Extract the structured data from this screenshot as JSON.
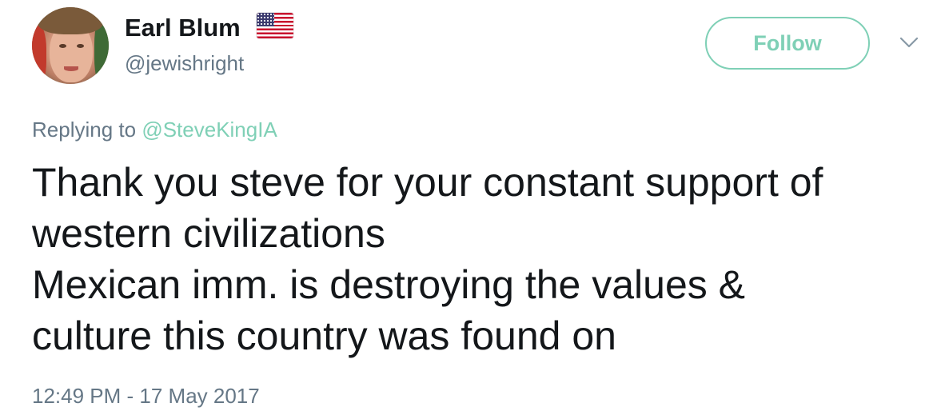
{
  "author": {
    "name": "Earl Blum",
    "flag_icon": "us-flag-icon",
    "handle": "@jewishright"
  },
  "follow_button": {
    "label": "Follow",
    "color": "#7fd0b6"
  },
  "menu": {
    "icon": "chevron-down-icon"
  },
  "reply": {
    "prefix": "Replying to",
    "mention": "@SteveKingIA"
  },
  "tweet": {
    "lines": [
      "Thank you steve for your constant support of",
      "western civilizations",
      "Mexican imm. is destroying the values &",
      "culture this country was found on"
    ],
    "timestamp": "12:49 PM - 17 May 2017"
  },
  "colors": {
    "text": "#14171a",
    "muted": "#657786",
    "accent": "#7fd0b6"
  }
}
